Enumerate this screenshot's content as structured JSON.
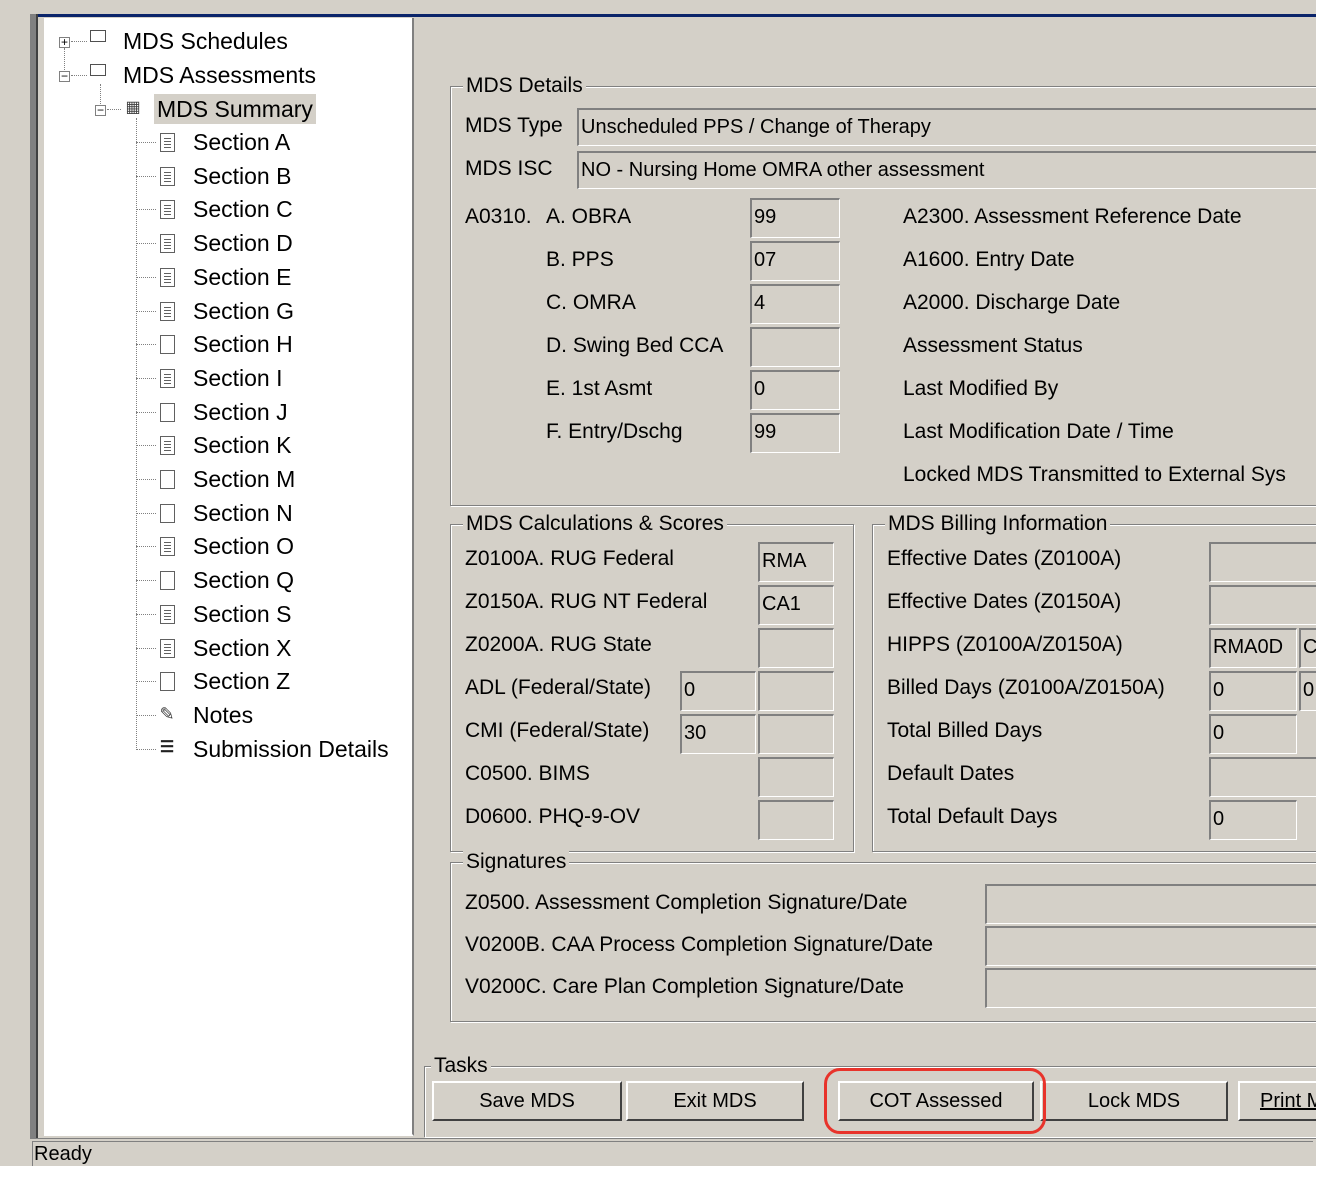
{
  "tree": {
    "schedules": "MDS Schedules",
    "assessments": "MDS Assessments",
    "summary": "MDS Summary",
    "items": [
      {
        "label": "Section A",
        "icon": "document-icon"
      },
      {
        "label": "Section B",
        "icon": "document-icon"
      },
      {
        "label": "Section C",
        "icon": "document-icon"
      },
      {
        "label": "Section D",
        "icon": "document-icon"
      },
      {
        "label": "Section E",
        "icon": "document-icon"
      },
      {
        "label": "Section G",
        "icon": "document-icon"
      },
      {
        "label": "Section H",
        "icon": "blank-document-icon"
      },
      {
        "label": "Section I",
        "icon": "document-icon"
      },
      {
        "label": "Section J",
        "icon": "blank-document-icon"
      },
      {
        "label": "Section K",
        "icon": "document-icon"
      },
      {
        "label": "Section M",
        "icon": "blank-document-icon"
      },
      {
        "label": "Section N",
        "icon": "blank-document-icon"
      },
      {
        "label": "Section O",
        "icon": "document-icon"
      },
      {
        "label": "Section Q",
        "icon": "blank-document-icon"
      },
      {
        "label": "Section S",
        "icon": "document-icon"
      },
      {
        "label": "Section X",
        "icon": "document-icon"
      },
      {
        "label": "Section Z",
        "icon": "blank-document-icon"
      },
      {
        "label": "Notes",
        "icon": "notes-edit-icon"
      },
      {
        "label": "Submission Details",
        "icon": "rss-feed-icon"
      }
    ]
  },
  "details": {
    "title": "MDS Details",
    "type_label": "MDS Type",
    "type_value": "Unscheduled PPS / Change of Therapy",
    "isc_label": "MDS ISC",
    "isc_value": "NO - Nursing Home OMRA other assessment",
    "a0310": "A0310.",
    "rows": [
      {
        "label": "A. OBRA",
        "value": "99"
      },
      {
        "label": "B. PPS",
        "value": "07"
      },
      {
        "label": "C. OMRA",
        "value": "4"
      },
      {
        "label": "D. Swing Bed CCA",
        "value": ""
      },
      {
        "label": "E. 1st Asmt",
        "value": "0"
      },
      {
        "label": "F. Entry/Dschg",
        "value": "99"
      }
    ],
    "right_labels": [
      "A2300. Assessment Reference Date",
      "A1600. Entry Date",
      "A2000. Discharge Date",
      "Assessment Status",
      "Last Modified By",
      "Last Modification Date / Time",
      "Locked MDS Transmitted to External Sys"
    ]
  },
  "calc": {
    "title": "MDS Calculations & Scores",
    "rows": [
      {
        "label": "Z0100A. RUG Federal",
        "value": "RMA"
      },
      {
        "label": "Z0150A. RUG NT Federal",
        "value": "CA1"
      },
      {
        "label": "Z0200A. RUG State",
        "value": ""
      },
      {
        "label": "ADL (Federal/State)",
        "value1": "0",
        "value2": ""
      },
      {
        "label": "CMI (Federal/State)",
        "value1": "30",
        "value2": ""
      },
      {
        "label": "C0500. BIMS",
        "value": ""
      },
      {
        "label": "D0600. PHQ-9-OV",
        "value": ""
      }
    ]
  },
  "billing": {
    "title": "MDS Billing Information",
    "rows": [
      {
        "label": "Effective Dates (Z0100A)",
        "value": ""
      },
      {
        "label": "Effective Dates (Z0150A)",
        "value": ""
      },
      {
        "label": "HIPPS (Z0100A/Z0150A)",
        "value": "RMA0D",
        "value2": "C"
      },
      {
        "label": "Billed Days (Z0100A/Z0150A)",
        "value": "0",
        "value2": "0"
      },
      {
        "label": "Total Billed Days",
        "value": "0"
      },
      {
        "label": "Default Dates",
        "value": ""
      },
      {
        "label": "Total Default Days",
        "value": "0"
      }
    ]
  },
  "signatures": {
    "title": "Signatures",
    "rows": [
      {
        "label": "Z0500. Assessment Completion Signature/Date",
        "value": ""
      },
      {
        "label": "V0200B. CAA Process Completion Signature/Date",
        "value": ""
      },
      {
        "label": "V0200C. Care Plan Completion Signature/Date",
        "value": ""
      }
    ]
  },
  "tasks": {
    "title": "Tasks",
    "save": "Save MDS",
    "exit": "Exit MDS",
    "cot": "COT Assessed",
    "lock": "Lock MDS",
    "print": "Print M"
  },
  "status": "Ready",
  "colors": {
    "highlight": "#e8332b",
    "face": "#d4d0c8"
  }
}
